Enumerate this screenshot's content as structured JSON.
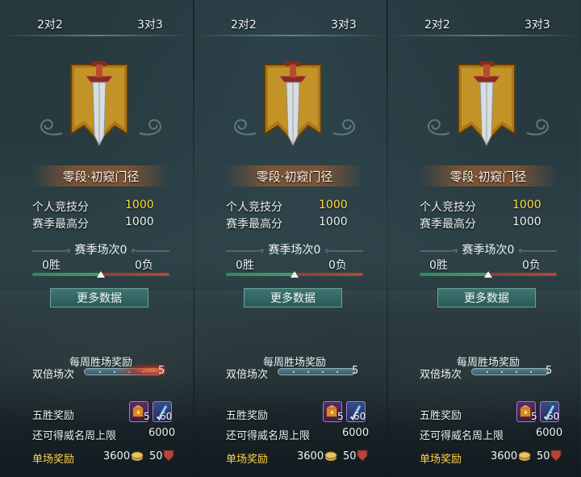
{
  "colors": {
    "gold_value": "#ffde3a",
    "single_reward_label": "#ffd24a",
    "win_bar": "#3fa06c",
    "loss_bar": "#b04a30",
    "button_bg": "#35665f",
    "reward_border": "#b071d3"
  },
  "panels": [
    {
      "tabs": [
        "2对2",
        "3对3"
      ],
      "rank_name": "零段·初窥门径",
      "personal_score_label": "个人竞技分",
      "personal_score": "1000",
      "season_best_label": "赛季最高分",
      "season_best": "1000",
      "season_matches": "赛季场次0",
      "wins": "0胜",
      "losses": "0负",
      "win_ratio": 0.5,
      "more_button": "更多数据",
      "weekly_title": "每周胜场奖励",
      "double_label": "双倍场次",
      "double_count": "5",
      "five_win_label": "五胜奖励",
      "reward_items": [
        {
          "icon": "chest-icon",
          "count": "5"
        },
        {
          "icon": "blade-icon",
          "count": "60"
        }
      ],
      "fame_label": "还可得威名周上限",
      "fame_value": "6000",
      "single_label": "单场奖励",
      "single_coin": "3600",
      "single_shield": "50"
    },
    {
      "tabs": [
        "2对2",
        "3对3"
      ],
      "rank_name": "零段·初窥门径",
      "personal_score_label": "个人竞技分",
      "personal_score": "1000",
      "season_best_label": "赛季最高分",
      "season_best": "1000",
      "season_matches": "赛季场次0",
      "wins": "0胜",
      "losses": "0负",
      "win_ratio": 0.5,
      "more_button": "更多数据",
      "weekly_title": "每周胜场奖励",
      "double_label": "双倍场次",
      "double_count": "5",
      "five_win_label": "五胜奖励",
      "reward_items": [
        {
          "icon": "chest-icon",
          "count": "5"
        },
        {
          "icon": "blade-icon",
          "count": "60"
        }
      ],
      "fame_label": "还可得威名周上限",
      "fame_value": "6000",
      "single_label": "单场奖励",
      "single_coin": "3600",
      "single_shield": "50"
    },
    {
      "tabs": [
        "2对2",
        "3对3"
      ],
      "rank_name": "零段·初窥门径",
      "personal_score_label": "个人竞技分",
      "personal_score": "1000",
      "season_best_label": "赛季最高分",
      "season_best": "1000",
      "season_matches": "赛季场次0",
      "wins": "0胜",
      "losses": "0负",
      "win_ratio": 0.5,
      "more_button": "更多数据",
      "weekly_title": "每周胜场奖励",
      "double_label": "双倍场次",
      "double_count": "5",
      "five_win_label": "五胜奖励",
      "reward_items": [
        {
          "icon": "chest-icon",
          "count": "5"
        },
        {
          "icon": "blade-icon",
          "count": "60"
        }
      ],
      "fame_label": "还可得威名周上限",
      "fame_value": "6000",
      "single_label": "单场奖励",
      "single_coin": "3600",
      "single_shield": "50"
    }
  ]
}
